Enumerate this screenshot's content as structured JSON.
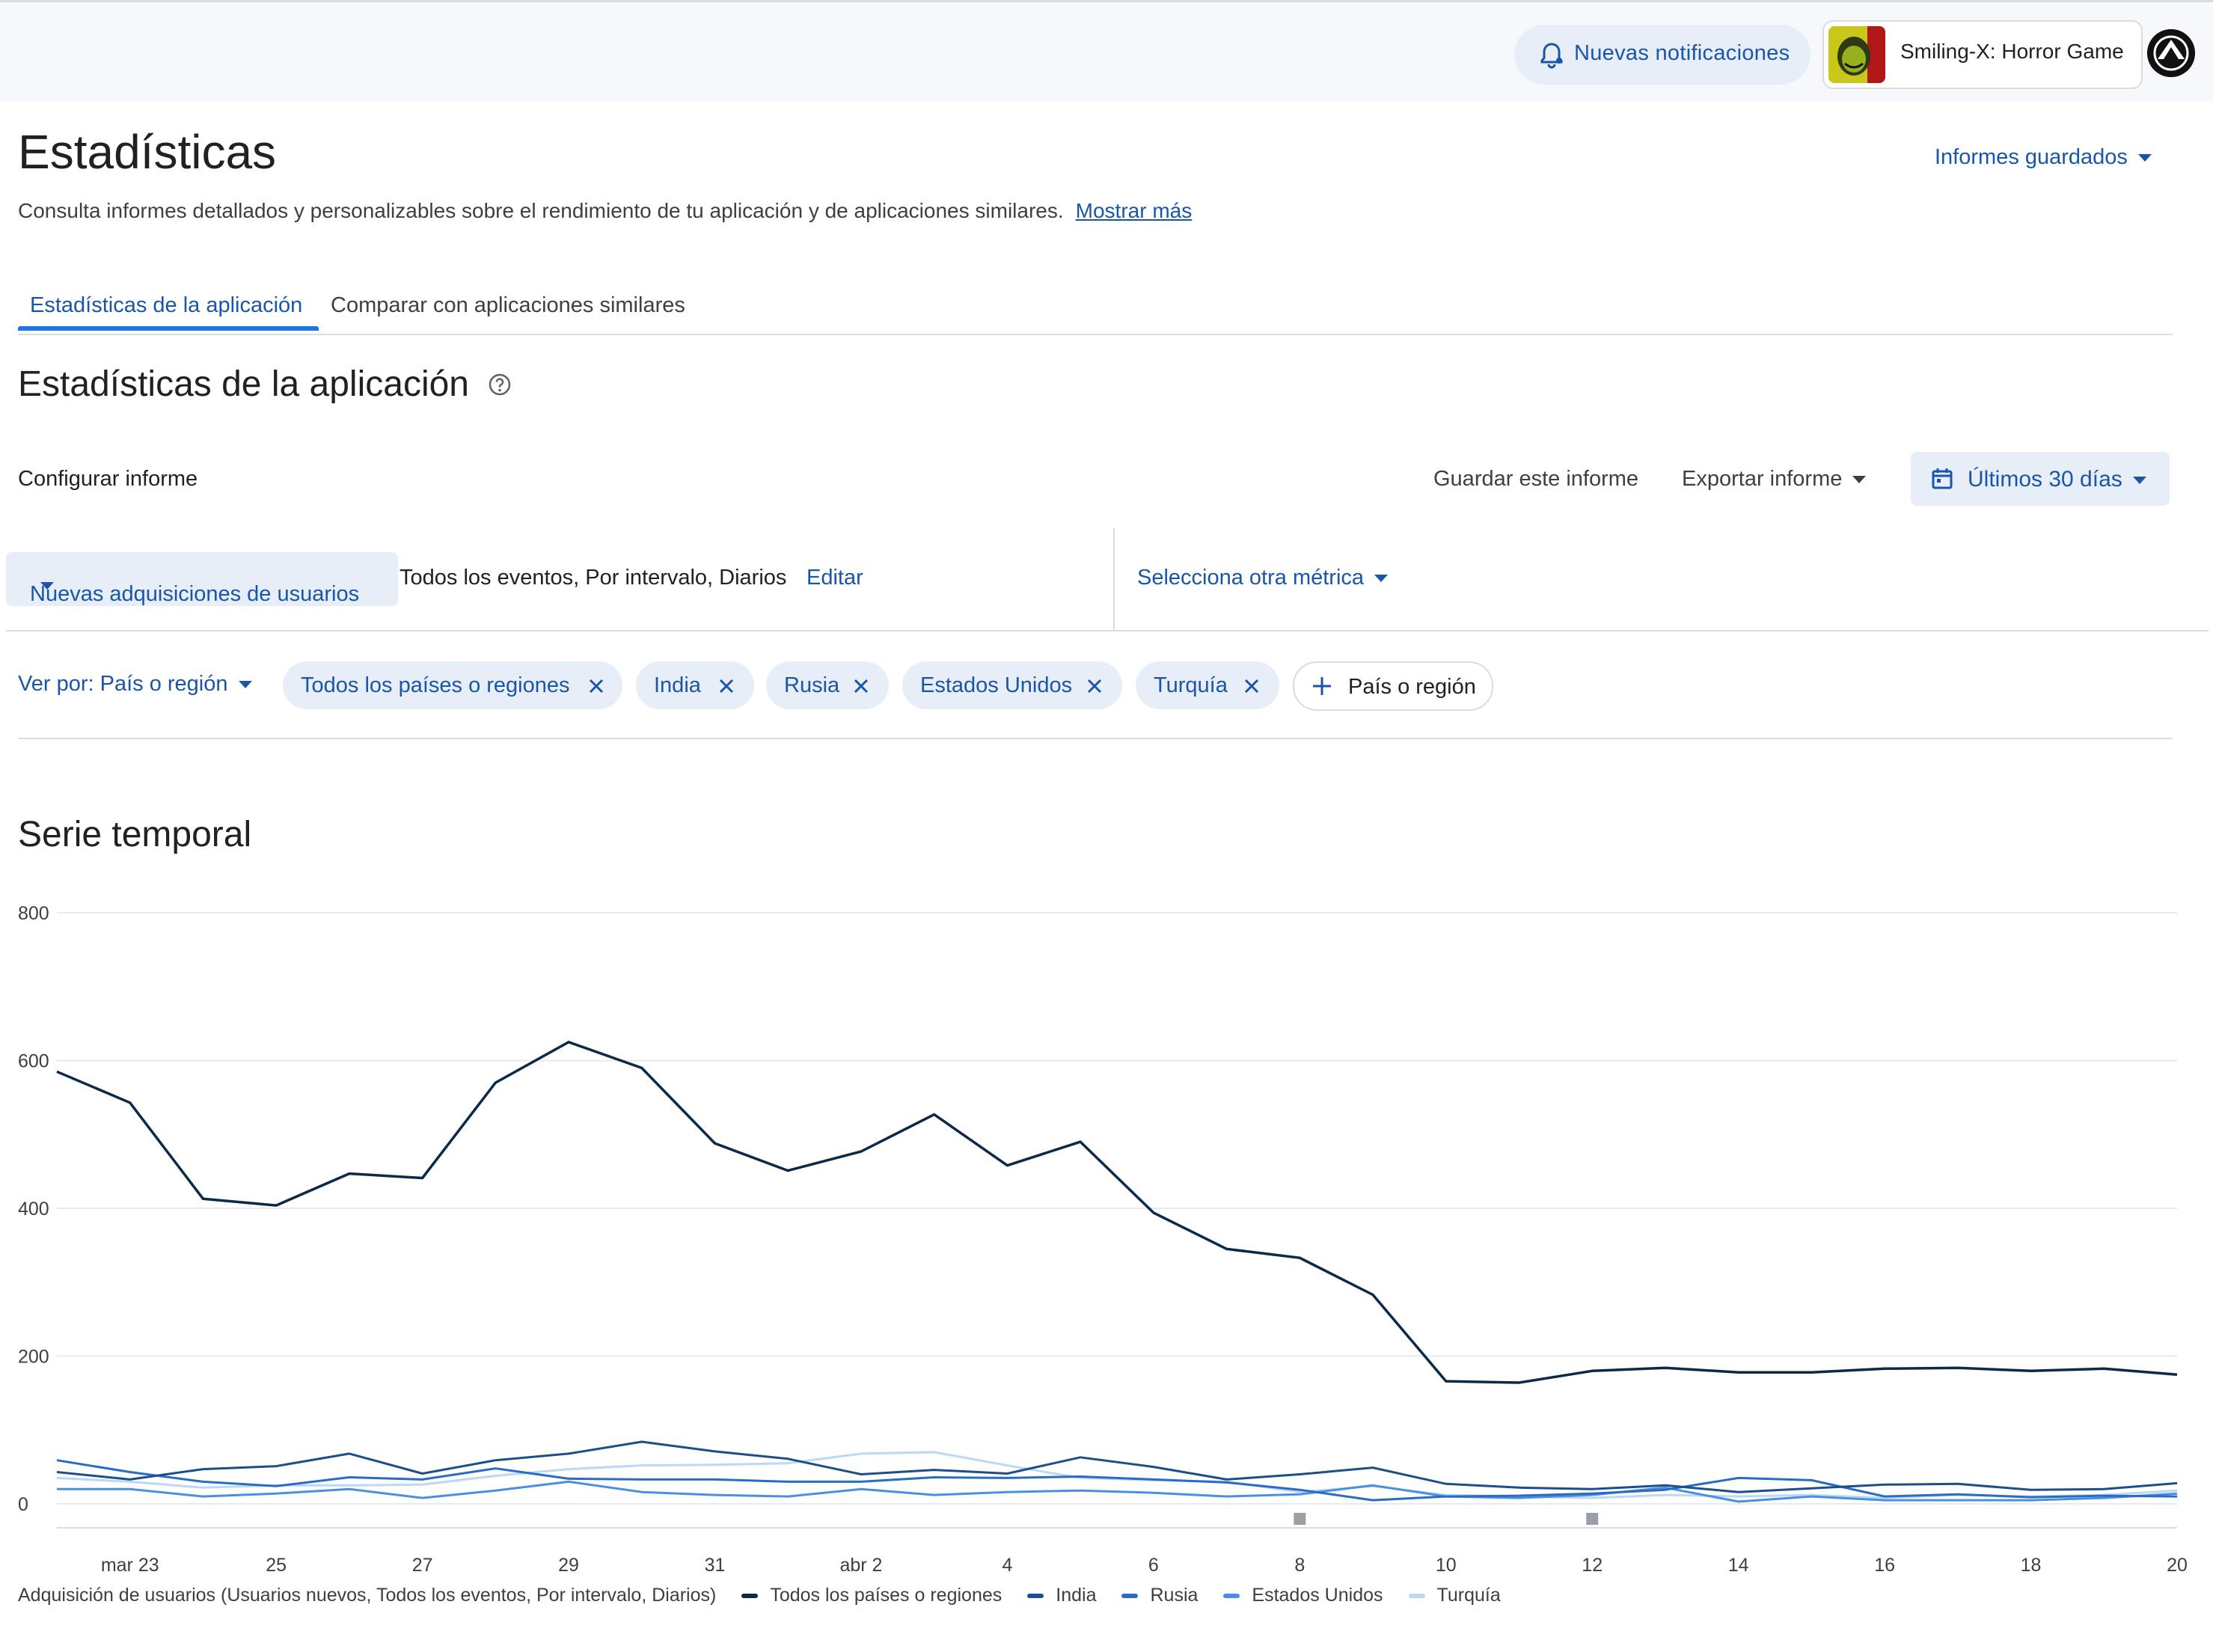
{
  "topbar": {
    "notifications_label": "Nuevas notificaciones",
    "app_name": "Smiling-X: Horror Game"
  },
  "header": {
    "title": "Estadísticas",
    "subtitle": "Consulta informes detallados y personalizables sobre el rendimiento de tu aplicación y de aplicaciones similares.",
    "show_more": "Mostrar más",
    "saved_reports": "Informes guardados"
  },
  "tabs": [
    {
      "label": "Estadísticas de la aplicación",
      "active": true
    },
    {
      "label": "Comparar con aplicaciones similares",
      "active": false
    }
  ],
  "section": {
    "title": "Estadísticas de la aplicación"
  },
  "config": {
    "label": "Configurar informe",
    "save_report": "Guardar este informe",
    "export_report": "Exportar informe",
    "date_range": "Últimos 30 días"
  },
  "metric": {
    "selected": "Nuevas adquisiciones de usuarios",
    "description": "Todos los eventos, Por intervalo, Diarios",
    "edit": "Editar",
    "other_metric": "Selecciona otra métrica"
  },
  "filters": {
    "view_by": "Ver por: País o región",
    "chips": [
      "Todos los países o regiones",
      "India",
      "Rusia",
      "Estados Unidos",
      "Turquía"
    ],
    "add_label": "País o región"
  },
  "chart_section": {
    "title": "Serie temporal"
  },
  "colors": {
    "accent": "#1a56a8",
    "chip_bg": "#e8eef8"
  },
  "chart_data": {
    "type": "line",
    "ylim": [
      0,
      800
    ],
    "y_ticks": [
      0,
      200,
      400,
      600,
      800
    ],
    "x_tick_labels": [
      "mar 23",
      "25",
      "27",
      "29",
      "31",
      "abr 2",
      "4",
      "6",
      "8",
      "10",
      "12",
      "14",
      "16",
      "18",
      "20"
    ],
    "x_tick_index": [
      1,
      3,
      5,
      7,
      9,
      11,
      13,
      15,
      17,
      19,
      21,
      23,
      25,
      27,
      29
    ],
    "dates": [
      "mar 22",
      "mar 23",
      "mar 24",
      "mar 25",
      "mar 26",
      "mar 27",
      "mar 28",
      "mar 29",
      "mar 30",
      "mar 31",
      "abr 1",
      "abr 2",
      "abr 3",
      "abr 4",
      "abr 5",
      "abr 6",
      "abr 7",
      "abr 8",
      "abr 9",
      "abr 10",
      "abr 11",
      "abr 12",
      "abr 13",
      "abr 14",
      "abr 15",
      "abr 16",
      "abr 17",
      "abr 18",
      "abr 19",
      "abr 20"
    ],
    "legend_title": "Adquisición de usuarios (Usuarios nuevos, Todos los eventos, Por intervalo, Diarios)",
    "legend_position": "bottom",
    "series": [
      {
        "name": "Todos los países o regiones",
        "color": "#0b2a4a",
        "values": [
          585,
          543,
          413,
          404,
          447,
          441,
          570,
          625,
          590,
          488,
          451,
          477,
          527,
          458,
          490,
          394,
          345,
          333,
          283,
          166,
          164,
          180,
          184,
          178,
          178,
          183,
          184,
          180,
          183,
          175
        ]
      },
      {
        "name": "India",
        "color": "#1c4f8a",
        "values": [
          43,
          33,
          47,
          51,
          68,
          41,
          59,
          68,
          84,
          71,
          61,
          40,
          46,
          41,
          63,
          50,
          33,
          40,
          49,
          27,
          22,
          20,
          25,
          16,
          21,
          26,
          27,
          19,
          20,
          28
        ]
      },
      {
        "name": "Rusia",
        "color": "#2a6cc4",
        "values": [
          59,
          43,
          30,
          24,
          36,
          33,
          48,
          34,
          33,
          33,
          30,
          30,
          36,
          35,
          37,
          33,
          29,
          19,
          5,
          10,
          11,
          14,
          19,
          35,
          32,
          10,
          13,
          9,
          11,
          10
        ]
      },
      {
        "name": "Estados Unidos",
        "color": "#4a90e2",
        "values": [
          20,
          20,
          10,
          14,
          20,
          8,
          18,
          30,
          16,
          12,
          10,
          20,
          12,
          16,
          18,
          15,
          10,
          13,
          25,
          10,
          8,
          12,
          22,
          3,
          10,
          5,
          5,
          5,
          8,
          14
        ]
      },
      {
        "name": "Turquía",
        "color": "#bcd8f5",
        "values": [
          35,
          30,
          22,
          25,
          25,
          26,
          38,
          47,
          52,
          53,
          55,
          68,
          70,
          52,
          35,
          32,
          30,
          16,
          24,
          12,
          10,
          8,
          12,
          10,
          12,
          8,
          12,
          10,
          12,
          18
        ]
      }
    ]
  }
}
